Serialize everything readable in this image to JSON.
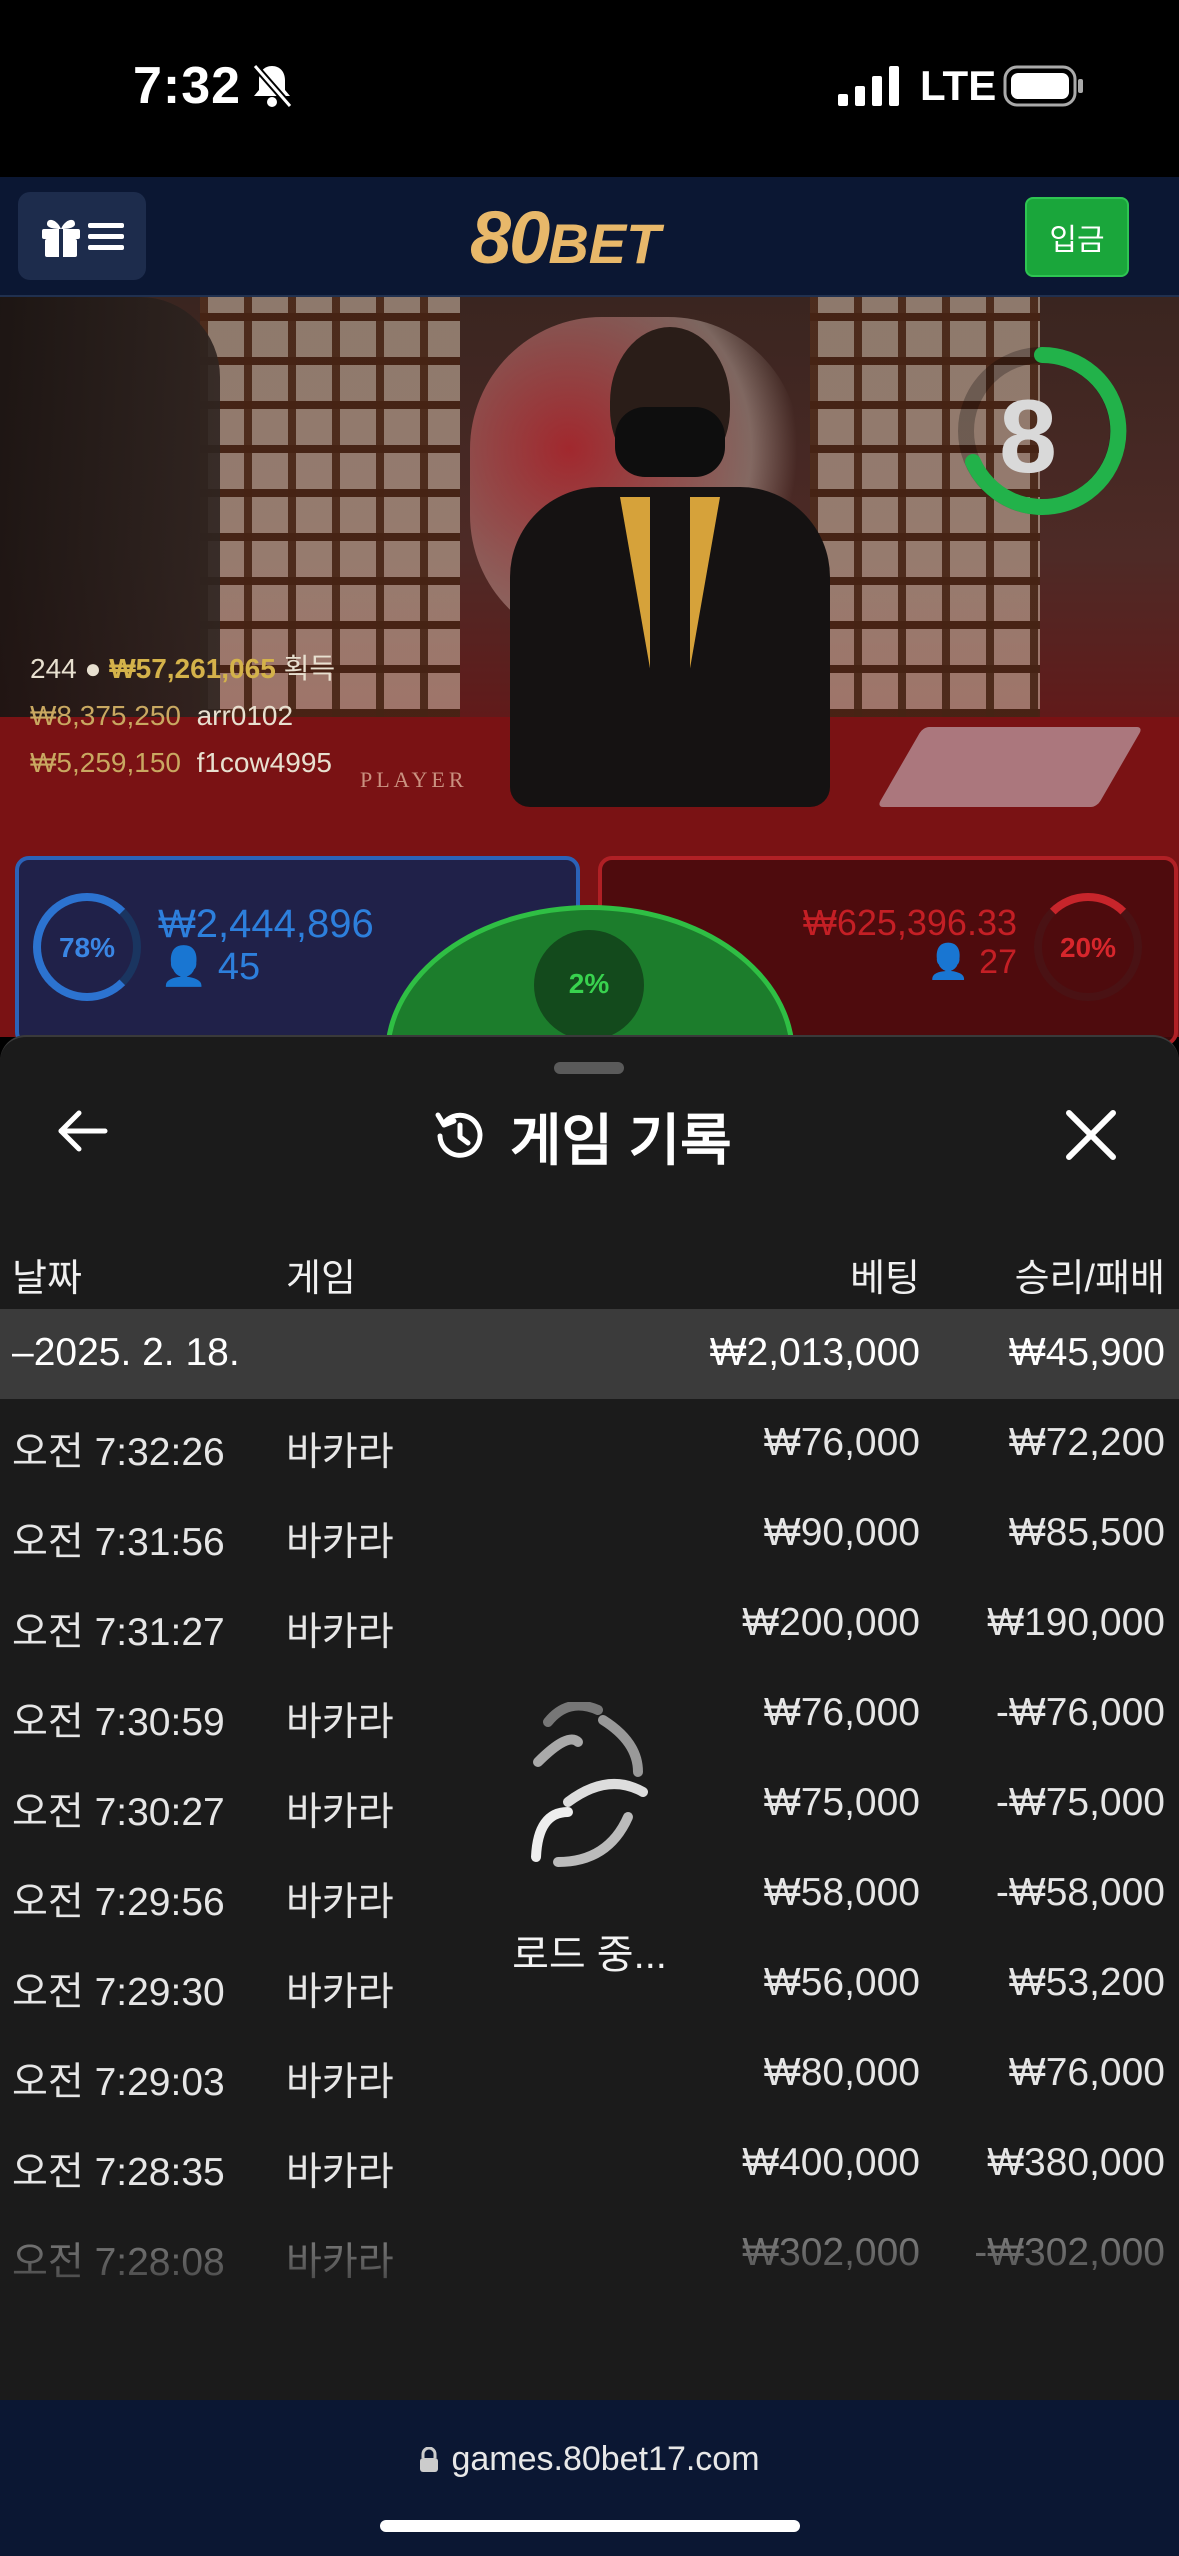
{
  "status_bar": {
    "time": "7:32",
    "network": "LTE"
  },
  "header": {
    "logo_main": "80",
    "logo_suffix": "BET",
    "deposit_label": "입금"
  },
  "game": {
    "countdown": "8",
    "stats": [
      {
        "a": "244",
        "b": "₩57,261,065",
        "c": "획득"
      },
      {
        "a": "₩8,375,250",
        "b": "arr0102"
      },
      {
        "a": "₩5,259,150",
        "b": "f1cow4995"
      }
    ],
    "felt_left": "PLAYER",
    "player": {
      "percent": "78%",
      "amount": "₩2,444,896",
      "count": "45"
    },
    "banker": {
      "percent": "20%",
      "amount": "₩625,396.33",
      "count": "27"
    },
    "tie": {
      "percent": "2%"
    }
  },
  "history": {
    "title": "게임 기록",
    "columns": {
      "date": "날짜",
      "game": "게임",
      "bet": "베팅",
      "result": "승리/패배"
    },
    "summary": {
      "date": "–2025. 2. 18.",
      "bet": "₩2,013,000",
      "result": "₩45,900"
    },
    "rows": [
      {
        "time": "오전 7:32:26",
        "game": "바카라",
        "bet": "₩76,000",
        "result": "₩72,200"
      },
      {
        "time": "오전 7:31:56",
        "game": "바카라",
        "bet": "₩90,000",
        "result": "₩85,500"
      },
      {
        "time": "오전 7:31:27",
        "game": "바카라",
        "bet": "₩200,000",
        "result": "₩190,000"
      },
      {
        "time": "오전 7:30:59",
        "game": "바카라",
        "bet": "₩76,000",
        "result": "-₩76,000"
      },
      {
        "time": "오전 7:30:27",
        "game": "바카라",
        "bet": "₩75,000",
        "result": "-₩75,000"
      },
      {
        "time": "오전 7:29:56",
        "game": "바카라",
        "bet": "₩58,000",
        "result": "-₩58,000"
      },
      {
        "time": "오전 7:29:30",
        "game": "바카라",
        "bet": "₩56,000",
        "result": "₩53,200"
      },
      {
        "time": "오전 7:29:03",
        "game": "바카라",
        "bet": "₩80,000",
        "result": "₩76,000"
      },
      {
        "time": "오전 7:28:35",
        "game": "바카라",
        "bet": "₩400,000",
        "result": "₩380,000"
      },
      {
        "time": "오전 7:28:08",
        "game": "바카라",
        "bet": "₩302,000",
        "result": "-₩302,000"
      }
    ],
    "loading_text": "로드 중..."
  },
  "browser": {
    "url": "games.80bet17.com"
  },
  "colors": {
    "header_bg": "#0b1733",
    "deposit": "#1aa63b",
    "player": "#2c73d0",
    "banker": "#c7252b",
    "tie": "#2fbf44",
    "logo": "#e8b86a"
  }
}
